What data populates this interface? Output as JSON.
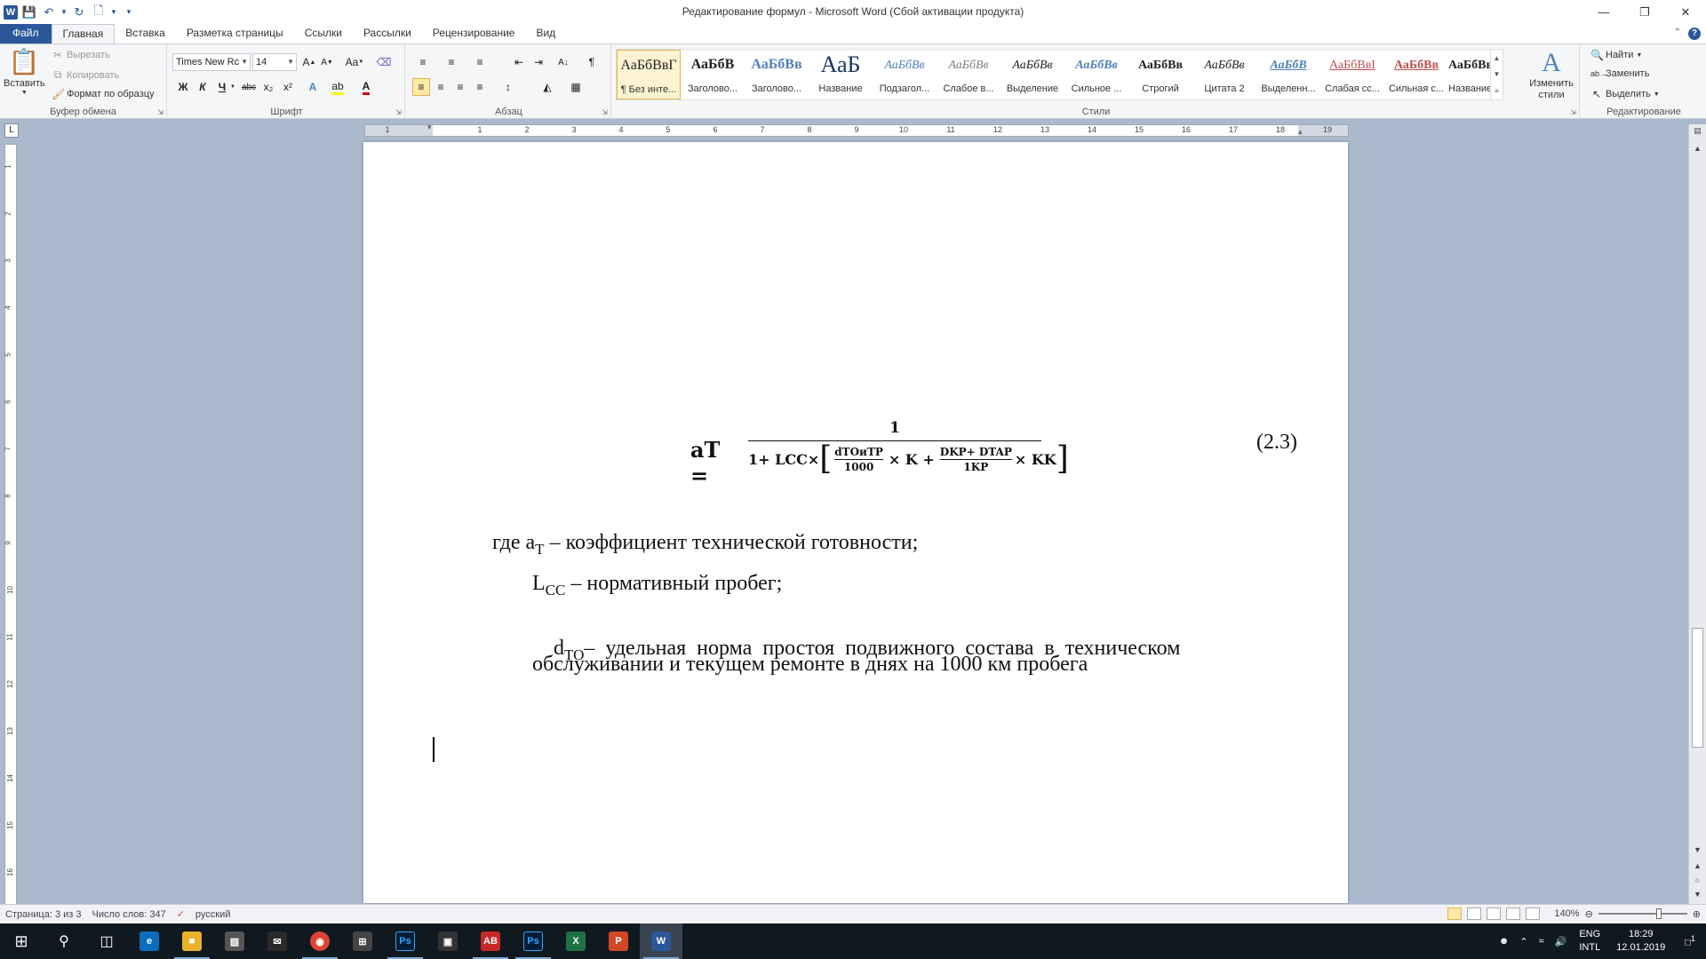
{
  "window": {
    "title": "Редактирование формул  -  Microsoft Word (Сбой активации продукта)",
    "app_letter": "W"
  },
  "tabs": [
    "Файл",
    "Главная",
    "Вставка",
    "Разметка страницы",
    "Ссылки",
    "Рассылки",
    "Рецензирование",
    "Вид"
  ],
  "clipboard": {
    "paste": "Вставить",
    "cut": "Вырезать",
    "copy": "Копировать",
    "format_painter": "Формат по образцу",
    "label": "Буфер обмена"
  },
  "font": {
    "name": "Times New Rc",
    "size": "14",
    "label": "Шрифт",
    "case_btn": "Aa",
    "bold": "Ж",
    "italic": "К",
    "underline": "Ч",
    "strike": "abc",
    "sub": "x₂",
    "sup": "x²"
  },
  "paragraph": {
    "label": "Абзац"
  },
  "styles": {
    "label": "Стили",
    "change_styles": "Изменить стили",
    "items": [
      {
        "sample": "АаБбВвГ",
        "name": "¶ Без инте...",
        "color": "#111111"
      },
      {
        "sample": "АаБбВ",
        "name": "Заголово...",
        "color": "#111111"
      },
      {
        "sample": "АаБбВв",
        "name": "Заголово...",
        "color": "#4f81bd"
      },
      {
        "sample": "АаБ",
        "name": "Название",
        "color": "#17365d"
      },
      {
        "sample": "АаБбВв",
        "name": "Подзагол...",
        "color": "#4f81bd"
      },
      {
        "sample": "АаБбВв",
        "name": "Слабое в...",
        "color": "#808080"
      },
      {
        "sample": "АаБбВв",
        "name": "Выделение",
        "color": "#111111"
      },
      {
        "sample": "АаБбВв",
        "name": "Сильное ...",
        "color": "#4f81bd"
      },
      {
        "sample": "АаБбВв",
        "name": "Строгий",
        "color": "#111111"
      },
      {
        "sample": "АаБбВв",
        "name": "Цитата 2",
        "color": "#111111"
      },
      {
        "sample": "АаБбВ",
        "name": "Выделенн...",
        "color": "#4f81bd"
      },
      {
        "sample": "АаБбВвІ",
        "name": "Слабая сс...",
        "color": "#c0504d"
      },
      {
        "sample": "АаБбВв",
        "name": "Сильная с...",
        "color": "#c0504d"
      },
      {
        "sample": "АаБбВв",
        "name": "Название...",
        "color": "#111111"
      }
    ]
  },
  "editing": {
    "find": "Найти",
    "replace": "Заменить",
    "select": "Выделить",
    "label": "Редактирование"
  },
  "ruler": {
    "h_numbers": [
      "1",
      "1",
      "2",
      "3",
      "4",
      "5",
      "6",
      "7",
      "8",
      "9",
      "10",
      "11",
      "12",
      "13",
      "14",
      "15",
      "16",
      "17",
      "18",
      "19"
    ],
    "v_numbers": [
      "1",
      "2",
      "3",
      "4",
      "5",
      "6",
      "7",
      "8",
      "9",
      "10",
      "11",
      "12",
      "13",
      "14",
      "15",
      "16"
    ]
  },
  "document": {
    "formula": {
      "lhs": "aT =",
      "numerator": "1",
      "den_prefix": "1+ LCC×",
      "frac1_num": "dTOиTP",
      "frac1_den": "1000",
      "times_k": "× K +",
      "frac2_num": "DKP+ DTAP",
      "frac2_den": "1KP",
      "times_kk": "× KK"
    },
    "equation_number": "(2.3)",
    "line1_prefix": "где a",
    "line1_sub": "T",
    "line1_text": " – коэффициент технической готовности;",
    "line2_prefix": "L",
    "line2_sub": "CC",
    "line2_text": " – нормативный пробег;",
    "line3_prefix": "d",
    "line3_sub": "TO",
    "line3_text": "–  удельная  норма  простоя  подвижного  состава  в  техническом",
    "line4_text": "обслуживании и текущем ремонте в днях на 1000 км пробега"
  },
  "status": {
    "page": "Страница: 3 из 3",
    "words": "Число слов: 347",
    "language": "русский",
    "zoom": "140%"
  },
  "taskbar": {
    "lang1": "ENG",
    "lang2": "INTL",
    "time": "18:29",
    "date": "12.01.2019",
    "notifications": "1"
  }
}
